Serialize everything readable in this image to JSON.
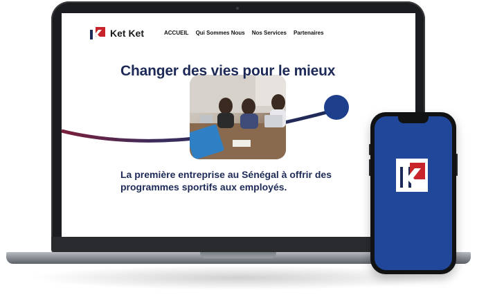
{
  "site": {
    "brand": "Ket Ket",
    "nav": [
      "ACCUEIL",
      "Qui Sommes Nous",
      "Nos Services",
      "Partenaires"
    ],
    "hero_title": "Changer des vies pour le mieux",
    "subtitle": "La première entreprise au Sénégal à offrir des programmes sportifs aux employés."
  },
  "colors": {
    "brand_navy": "#1d2a57",
    "brand_red": "#c8242b",
    "phone_blue": "#21479a"
  },
  "icons": {
    "logo": "ketket-logo-icon",
    "photo": "meeting-photo"
  }
}
